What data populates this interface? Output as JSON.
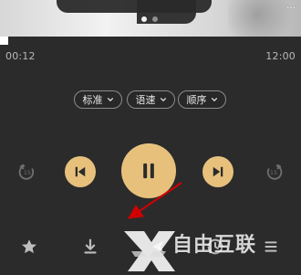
{
  "cover": {
    "mark_text": "…",
    "dots": [
      {
        "active": true
      },
      {
        "active": false
      }
    ]
  },
  "progress": {
    "current_time": "00:12",
    "duration": "12:00",
    "fraction": 0.02
  },
  "pills": [
    {
      "label": "标准",
      "icon": "chevron-down-icon"
    },
    {
      "label": "语速",
      "icon": "chevron-down-icon"
    },
    {
      "label": "顺序",
      "icon": "chevron-down-icon"
    }
  ],
  "controls": {
    "rewind_icon": "rewind-15-icon",
    "previous_icon": "skip-previous-icon",
    "play_pause_icon": "pause-icon",
    "next_icon": "skip-next-icon",
    "forward_icon": "forward-15-icon",
    "accent_color": "#e7c17c"
  },
  "bottom_actions": [
    {
      "name": "favorite",
      "icon": "star-icon"
    },
    {
      "name": "download",
      "icon": "download-icon"
    },
    {
      "name": "share",
      "icon": "share-icon"
    },
    {
      "name": "timer",
      "icon": "clock-icon"
    },
    {
      "name": "playlist",
      "icon": "list-icon"
    }
  ],
  "overlay": {
    "watermark_text": "自由互联",
    "arrow_color": "#d10000"
  }
}
